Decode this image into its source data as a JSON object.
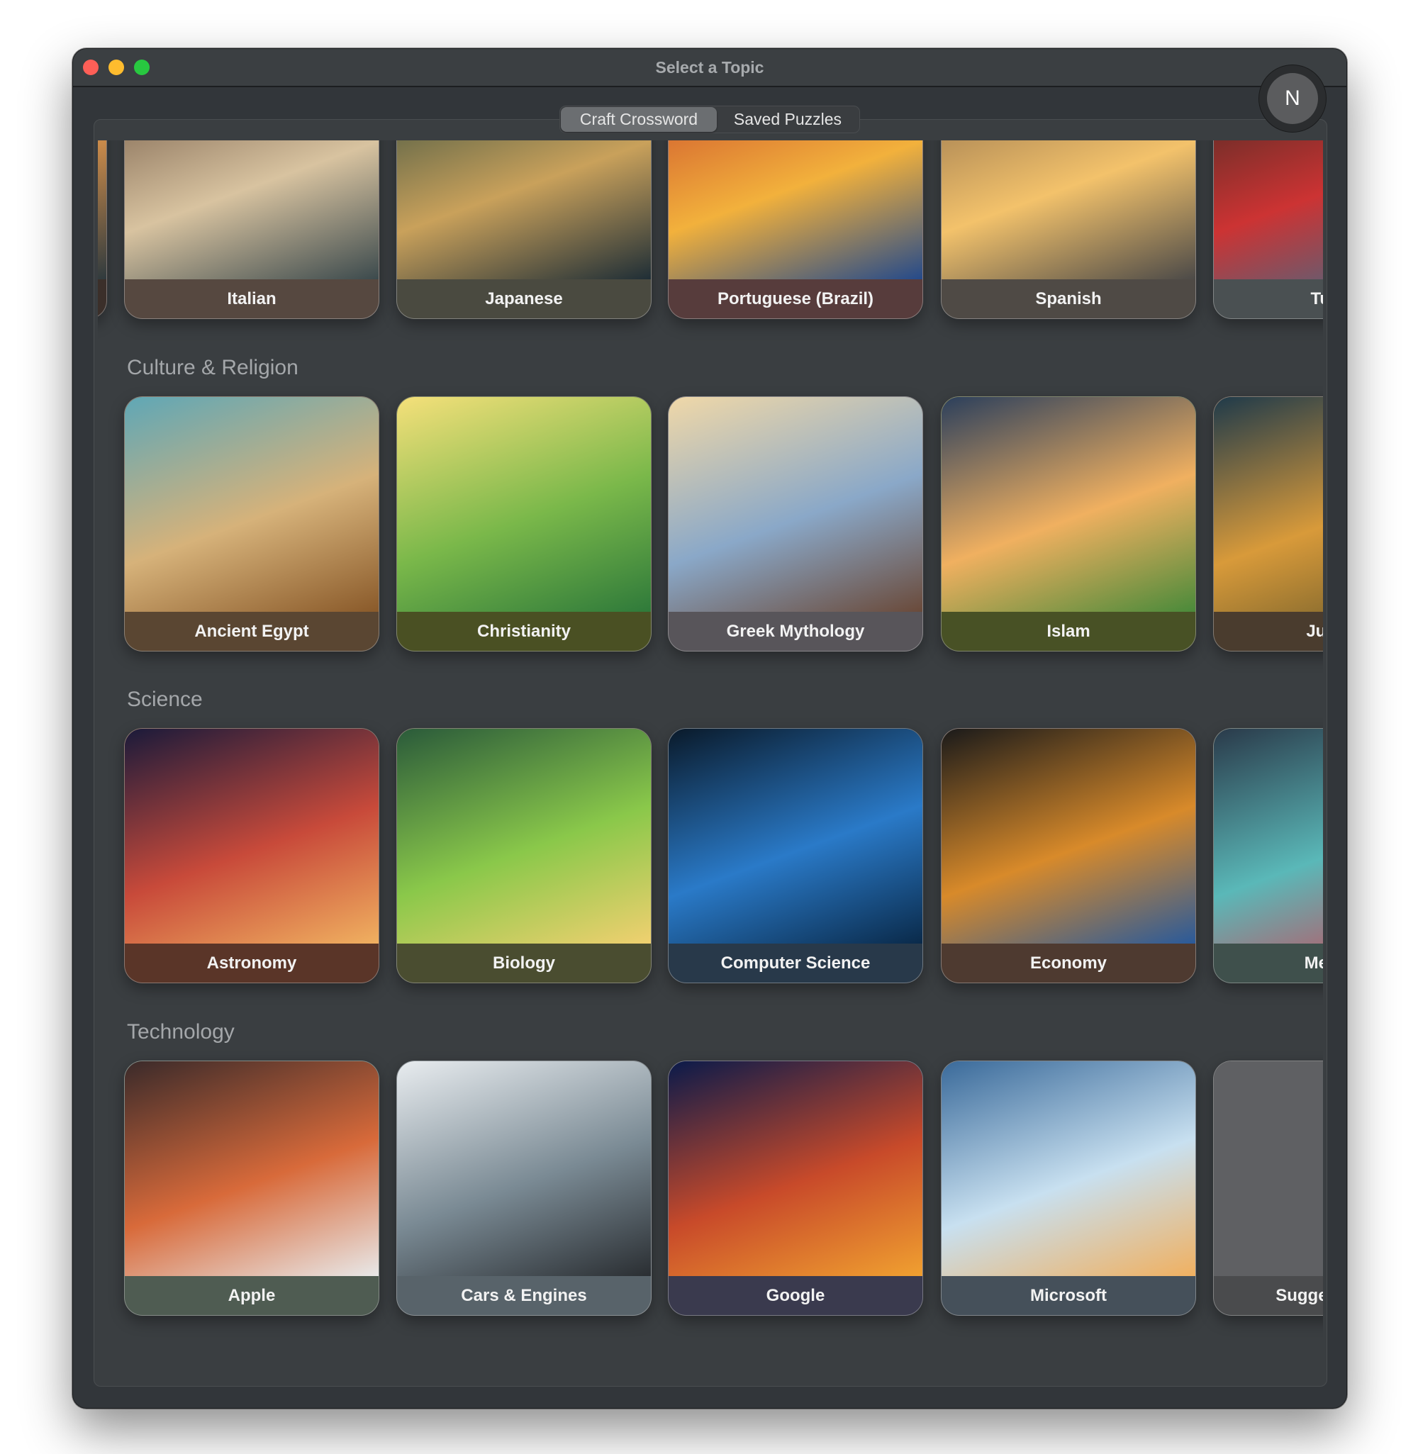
{
  "window": {
    "title": "Select a Topic"
  },
  "avatar": {
    "initial": "N"
  },
  "tabs": [
    {
      "label": "Craft Crossword",
      "selected": true
    },
    {
      "label": "Saved Puzzles",
      "selected": false
    }
  ],
  "sections": [
    {
      "title": "",
      "cards": [
        {
          "label": "",
          "img": [
            "#7a4a2e",
            "#c98a4a",
            "#2f3a3e"
          ],
          "band": "#3b2f2a"
        },
        {
          "label": "Italian",
          "img": [
            "#6b5240",
            "#d8c3a0",
            "#3c4a4d"
          ],
          "band": "#564840"
        },
        {
          "label": "Japanese",
          "img": [
            "#2f4a3e",
            "#c9a15b",
            "#1f2e36"
          ],
          "band": "#4a4a40"
        },
        {
          "label": "Portuguese (Brazil)",
          "img": [
            "#c8462a",
            "#f2b13c",
            "#254a8a"
          ],
          "band": "#573c3c"
        },
        {
          "label": "Spanish",
          "img": [
            "#8a6a4a",
            "#f3c26b",
            "#4c4a48"
          ],
          "band": "#4f4a45"
        },
        {
          "label": "Turkish",
          "img": [
            "#3b2a22",
            "#c33",
            "#3a6e8a"
          ],
          "band": "#4a5052"
        }
      ]
    },
    {
      "title": "Culture & Religion",
      "cards": [
        {
          "label": "Ancient Egypt",
          "img": [
            "#5fa7b6",
            "#d6b27a",
            "#8a5a2a"
          ],
          "band": "#5a4632"
        },
        {
          "label": "Christianity",
          "img": [
            "#f5e07a",
            "#7ab84a",
            "#2f7a3a"
          ],
          "band": "#4a5023"
        },
        {
          "label": "Greek Mythology",
          "img": [
            "#f0d8a8",
            "#8aa8c8",
            "#6a4a3a"
          ],
          "band": "#58555a"
        },
        {
          "label": "Islam",
          "img": [
            "#2b3f5c",
            "#f0b060",
            "#4a8a3a"
          ],
          "band": "#485125"
        },
        {
          "label": "Judaism",
          "img": [
            "#1f3a4a",
            "#d89a3a",
            "#6a5a2a"
          ],
          "band": "#4a3c2e"
        }
      ]
    },
    {
      "title": "Science",
      "cards": [
        {
          "label": "Astronomy",
          "img": [
            "#1a1a3a",
            "#c84a3a",
            "#f0b060"
          ],
          "band": "#5a3528"
        },
        {
          "label": "Biology",
          "img": [
            "#2a5a3a",
            "#8ac84a",
            "#f0d070"
          ],
          "band": "#4a4d30"
        },
        {
          "label": "Computer Science",
          "img": [
            "#0a1a2a",
            "#2a7ac8",
            "#0a2a4a"
          ],
          "band": "#28394a"
        },
        {
          "label": "Economy",
          "img": [
            "#1a1a1a",
            "#d88a2a",
            "#2a5a9a"
          ],
          "band": "#4e3a30"
        },
        {
          "label": "Medicine",
          "img": [
            "#2a3a4a",
            "#5ab8b8",
            "#c84a5a"
          ],
          "band": "#3f504c"
        }
      ]
    },
    {
      "title": "Technology",
      "cards": [
        {
          "label": "Apple",
          "img": [
            "#3a2a2a",
            "#d86a3a",
            "#e8e8e8"
          ],
          "band": "#4f5c52"
        },
        {
          "label": "Cars & Engines",
          "img": [
            "#e8ecef",
            "#7a8a94",
            "#2a2e32"
          ],
          "band": "#58636a"
        },
        {
          "label": "Google",
          "img": [
            "#0a1a4a",
            "#c84a2a",
            "#f0a030"
          ],
          "band": "#3a3a4e"
        },
        {
          "label": "Microsoft",
          "img": [
            "#3a6a9a",
            "#c8e0f0",
            "#f0b060"
          ],
          "band": "#45505a"
        },
        {
          "label": "Suggest a Topic",
          "img": [
            "#5f6063",
            "#5f6063",
            "#5f6063"
          ],
          "band": "#4a4b4d"
        }
      ]
    }
  ]
}
